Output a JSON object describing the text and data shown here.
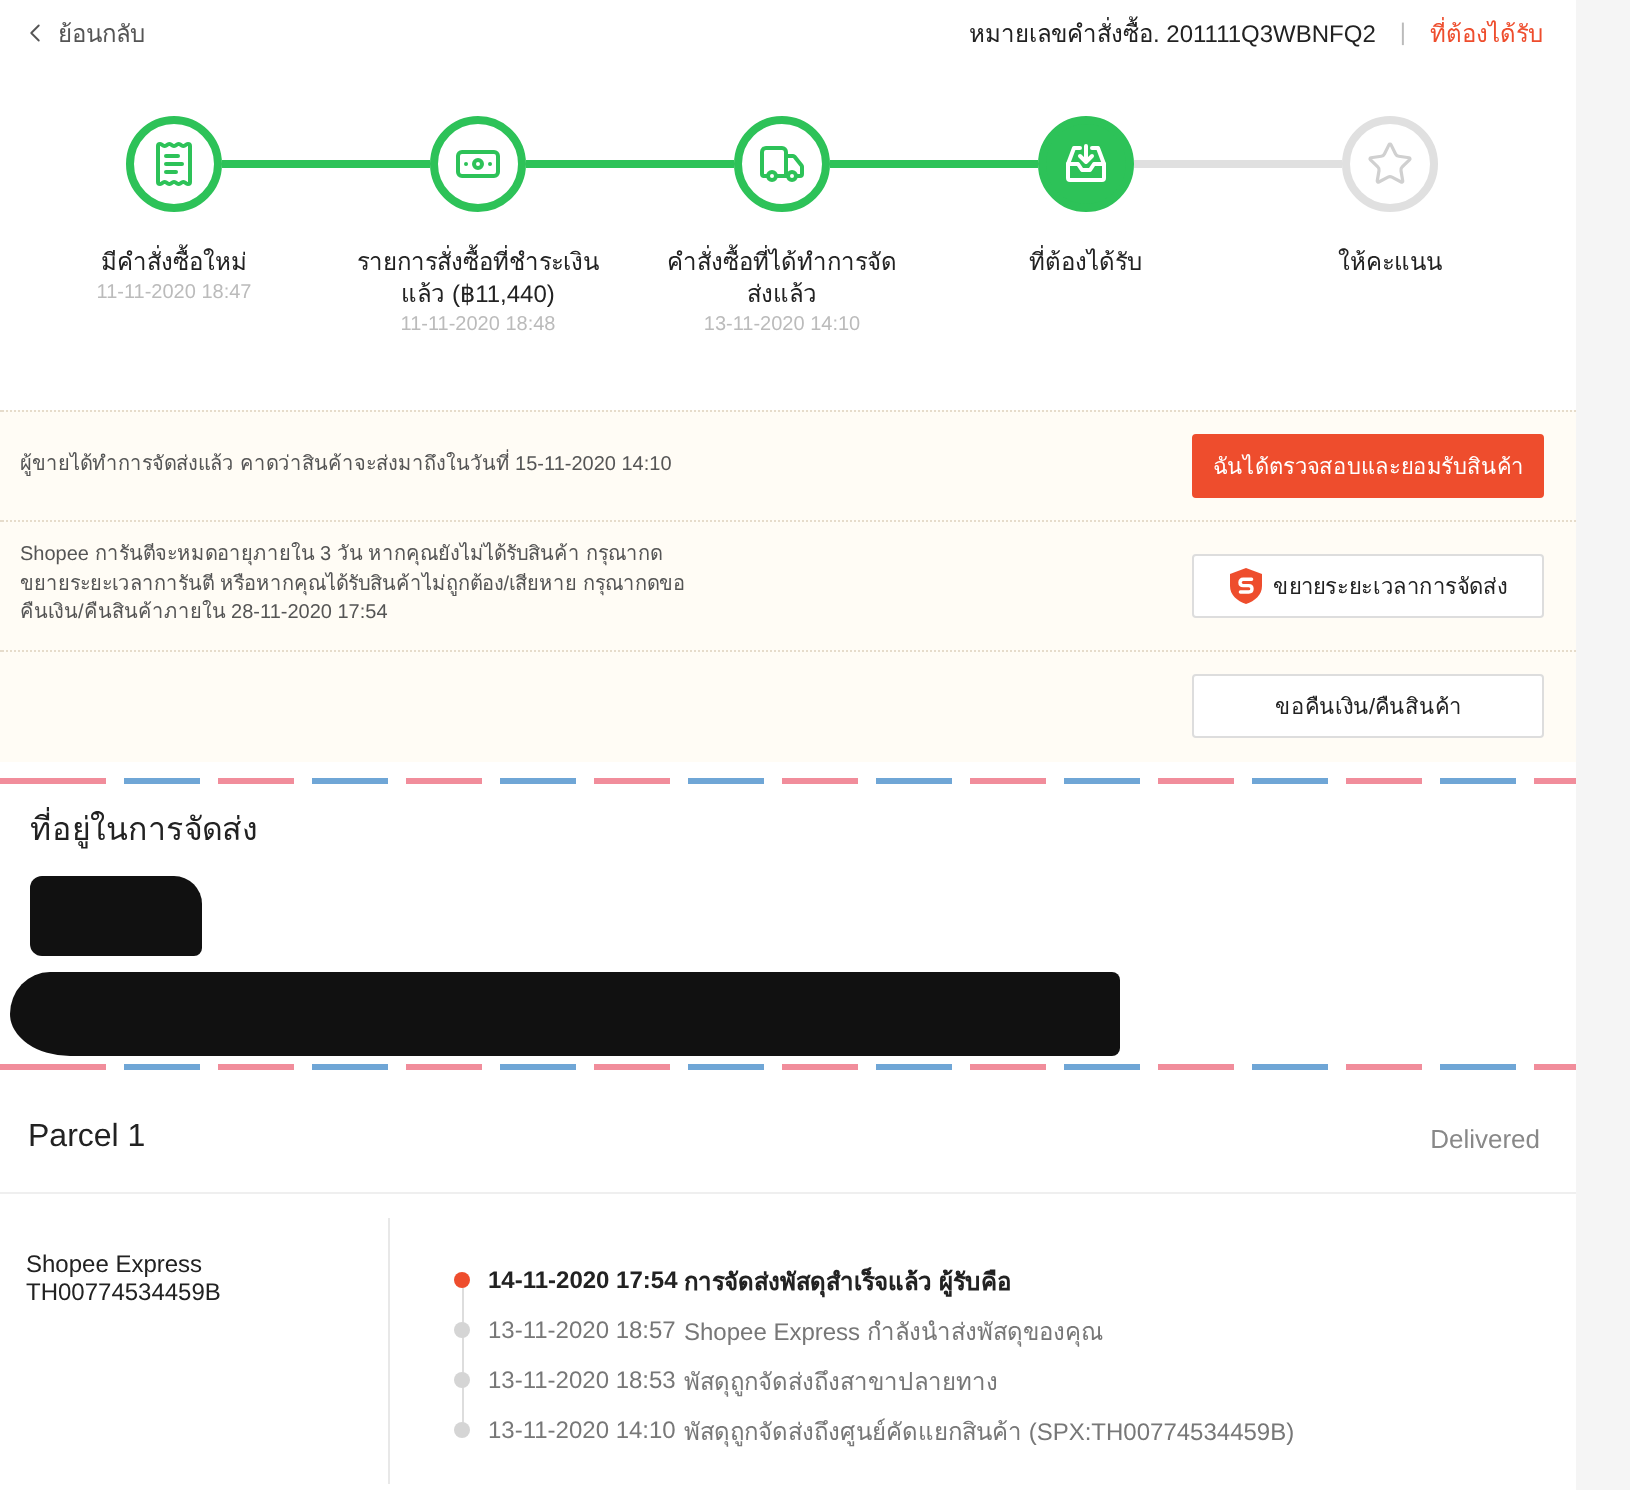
{
  "top_bar": {
    "back": {
      "label": "ย้อนกลับ"
    },
    "order_number": "หมายเลขคำสั่งซื้อ. 201111Q3WBNFQ2",
    "separator": "|",
    "order_status": "ที่ต้องได้รับ"
  },
  "steps": [
    {
      "label": "มีคำสั่งซื้อใหม่",
      "date": "11-11-2020 18:47",
      "reached": true,
      "current": false
    },
    {
      "label": "รายการสั่งซื้อที่ชำระเงินแล้ว (฿11,440)",
      "date": "11-11-2020 18:48",
      "reached": true,
      "current": false
    },
    {
      "label": "คำสั่งซื้อที่ได้ทำการจัดส่งแล้ว",
      "date": "13-11-2020 14:10",
      "reached": true,
      "current": false
    },
    {
      "label": "ที่ต้องได้รับ",
      "reached": true,
      "current": true
    },
    {
      "label": "ให้คะแนน",
      "reached": false,
      "current": false
    }
  ],
  "actions": [
    {
      "text": "ผู้ขายได้ทำการจัดส่งแล้ว คาดว่าสินค้าจะส่งมาถึงในวันที่ 15-11-2020 14:10",
      "button": {
        "label": "ฉันได้ตรวจสอบและยอมรับสินค้า",
        "kind": "primary"
      }
    },
    {
      "text": "Shopee การันตีจะหมดอายุภายใน 3 วัน หากคุณยังไม่ได้รับสินค้า กรุณากดขยายระยะเวลาการันตี หรือหากคุณได้รับสินค้าไม่ถูกต้อง/เสียหาย กรุณากดขอคืนเงิน/คืนสินค้าภายใน 28-11-2020 17:54",
      "button": {
        "label": "ขยายระยะเวลาการจัดส่ง",
        "kind": "guarantee"
      }
    },
    {
      "button": {
        "label": "ขอคืนเงิน/คืนสินค้า",
        "kind": "plain"
      }
    }
  ],
  "address": {
    "title": "ที่อยู่ในการจัดส่ง",
    "redacted": true
  },
  "parcel": {
    "title": "Parcel 1",
    "status": "Delivered",
    "carrier": "Shopee Express",
    "tracking_number": "TH00774534459B",
    "events": [
      {
        "time": "14-11-2020 17:54",
        "description": "การจัดส่งพัสดุสำเร็จแล้ว ผู้รับคือ",
        "current": true
      },
      {
        "time": "13-11-2020 18:57",
        "description": "Shopee Express กำลังนำส่งพัสดุของคุณ",
        "current": false
      },
      {
        "time": "13-11-2020 18:53",
        "description": "พัสดุถูกจัดส่งถึงสาขาปลายทาง",
        "current": false
      },
      {
        "time": "13-11-2020 14:10",
        "description": "พัสดุถูกจัดส่งถึงศูนย์คัดแยกสินค้า (SPX:TH00774534459B)",
        "current": false
      }
    ]
  }
}
